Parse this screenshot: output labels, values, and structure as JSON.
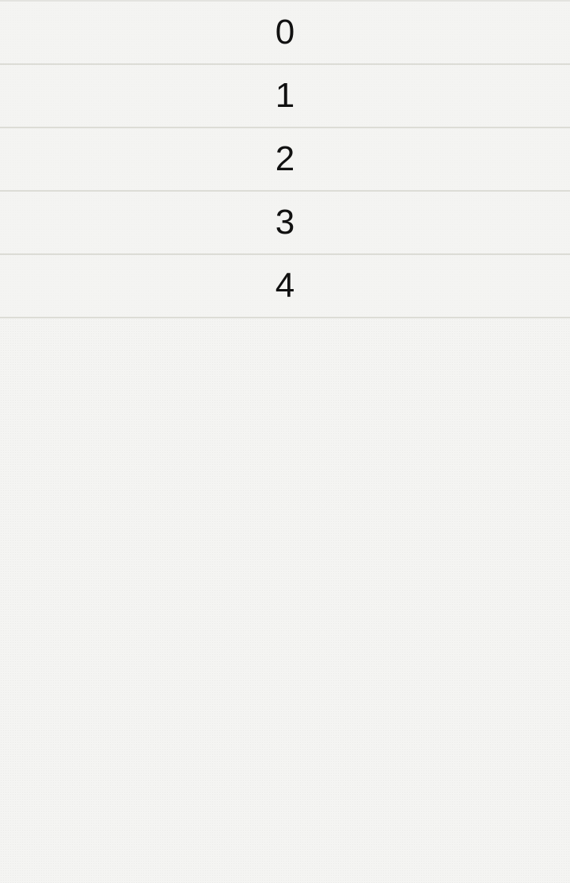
{
  "list": {
    "items": [
      {
        "label": "0"
      },
      {
        "label": "1"
      },
      {
        "label": "2"
      },
      {
        "label": "3"
      },
      {
        "label": "4"
      }
    ]
  }
}
